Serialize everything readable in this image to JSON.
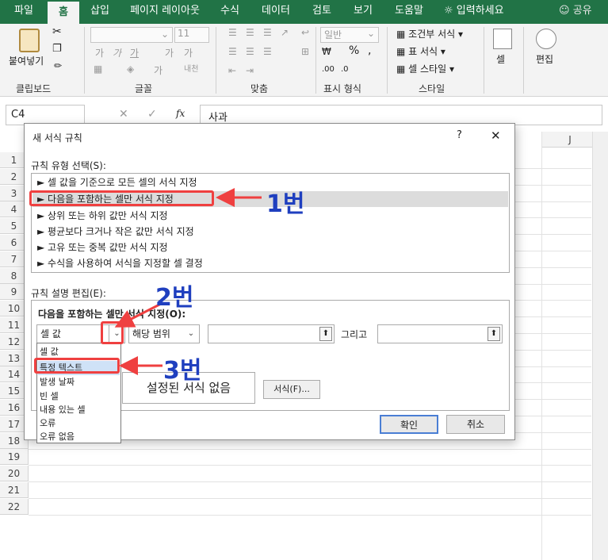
{
  "ribbon_tabs": [
    "파일",
    "홈",
    "삽입",
    "페이지 레이아웃",
    "수식",
    "데이터",
    "검토",
    "보기",
    "도움말"
  ],
  "tell_me": "입력하세요",
  "share": "공유",
  "ribbon": {
    "paste": "붙여넣기",
    "clipboard": "클립보드",
    "font_group": "글꼴",
    "font_size": "11",
    "bold": "가",
    "align_group": "맞춤",
    "number_format": "일반",
    "number_group": "표시 형식",
    "cond_format": "조건부 서식",
    "table_format": "표 서식",
    "cell_style": "셀 스타일",
    "style_group": "스타일",
    "cells": "셀",
    "editing": "편집"
  },
  "formula_bar": {
    "name_box": "C4",
    "value": "사과",
    "fx": "fx"
  },
  "grid": {
    "rows": [
      "1",
      "2",
      "3",
      "4",
      "5",
      "6",
      "7",
      "8",
      "9",
      "10",
      "11",
      "12",
      "13",
      "14",
      "15",
      "16",
      "17",
      "18",
      "19",
      "20",
      "21",
      "22"
    ],
    "col_j": "J"
  },
  "dialog": {
    "title": "새 서식 규칙",
    "help": "?",
    "close": "✕",
    "rule_type_label": "규칙 유형 선택(S):",
    "rule_types": [
      "► 셀 값을 기준으로 모든 셀의 서식 지정",
      "► 다음을 포함하는 셀만 서식 지정",
      "► 상위 또는 하위 값만 서식 지정",
      "► 평균보다 크거나 작은 값만 서식 지정",
      "► 고유 또는 중복 값만 서식 지정",
      "► 수식을 사용하여 서식을 지정할 셀 결정"
    ],
    "edit_label": "규칙 설명 편집(E):",
    "edit_title": "다음을 포함하는 셀만 서식 지정(O):",
    "cond1": "셀 값",
    "cond2": "해당 범위",
    "and_label": "그리고",
    "preview": "설정된 서식 없음",
    "format_button": "서식(F)...",
    "ok": "확인",
    "cancel": "취소"
  },
  "dropdown_options": [
    "셀 값",
    "특정 텍스트",
    "발생 날짜",
    "빈 셀",
    "내용 있는 셀",
    "오류",
    "오류 없음"
  ],
  "annotations": {
    "a1": "1번",
    "a2": "2번",
    "a3": "3번"
  }
}
